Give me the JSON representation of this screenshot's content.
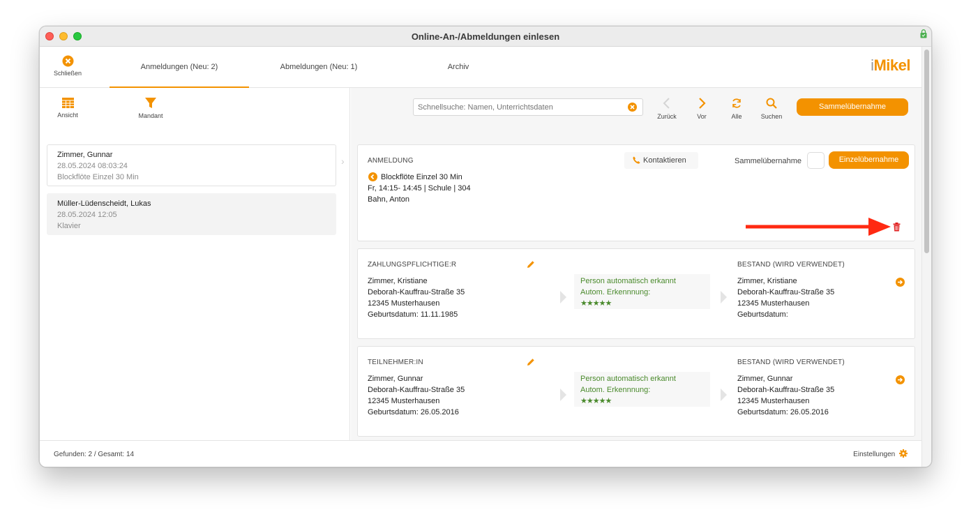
{
  "window": {
    "title": "Online-An-/Abmeldungen einlesen"
  },
  "topbar": {
    "close_label": "Schließen",
    "tabs": [
      {
        "label": "Anmeldungen (Neu: 2)",
        "active": true
      },
      {
        "label": "Abmeldungen (Neu: 1)",
        "active": false
      },
      {
        "label": "Archiv",
        "active": false
      }
    ],
    "logo": {
      "prefix": "i",
      "text": "Mikel"
    }
  },
  "left": {
    "tools": [
      {
        "label": "Ansicht",
        "icon": "grid-icon"
      },
      {
        "label": "Mandant",
        "icon": "filter-icon"
      }
    ],
    "entries": [
      {
        "name": "Zimmer, Gunnar",
        "date": "28.05.2024 08:03:24",
        "course": "Blockflöte Einzel 30 Min",
        "selected": false
      },
      {
        "name": "Müller-Lüdenscheidt, Lukas",
        "date": "28.05.2024 12:05",
        "course": "Klavier",
        "selected": true
      }
    ]
  },
  "right": {
    "search": {
      "placeholder": "Schnellsuche: Namen, Unterrichtsdaten"
    },
    "nav": {
      "back": "Zurück",
      "next": "Vor",
      "all": "Alle",
      "search": "Suchen"
    },
    "bulk_button": "Sammelübernahme",
    "anmeldung": {
      "heading": "ANMELDUNG",
      "contact": "Kontaktieren",
      "bulk_label": "Sammelübernahme",
      "single_button": "Einzelübernahme",
      "course": "Blockflöte Einzel 30 Min",
      "schedule": "Fr, 14:15- 14:45 | Schule | 304",
      "teacher": "Bahn, Anton"
    },
    "payer": {
      "heading": "ZAHLUNGSPFLICHTIGE:R",
      "lines": [
        "Zimmer, Kristiane",
        "Deborah-Kauffrau-Straße 35",
        "12345 Musterhausen",
        "Geburtsdatum: 11.11.1985"
      ],
      "match": [
        "Person automatisch erkannt",
        "Autom. Erkennnung:",
        "★★★★★"
      ],
      "existing_heading": "BESTAND (WIRD VERWENDET)",
      "existing": [
        "Zimmer, Kristiane",
        "Deborah-Kauffrau-Straße 35",
        "12345 Musterhausen",
        "Geburtsdatum:"
      ]
    },
    "participant": {
      "heading": "TEILNEHMER:IN",
      "lines": [
        "Zimmer, Gunnar",
        "Deborah-Kauffrau-Straße 35",
        "12345 Musterhausen",
        "Geburtsdatum: 26.05.2016"
      ],
      "match": [
        "Person automatisch erkannt",
        "Autom. Erkennnung:",
        "★★★★★"
      ],
      "existing_heading": "BESTAND (WIRD VERWENDET)",
      "existing": [
        "Zimmer, Gunnar",
        "Deborah-Kauffrau-Straße 35",
        "12345 Musterhausen",
        "Geburtsdatum: 26.05.2016"
      ]
    }
  },
  "footer": {
    "status": "Gefunden: 2 / Gesamt: 14",
    "settings": "Einstellungen"
  },
  "colors": {
    "accent": "#f39200",
    "annotation_arrow": "#ff2a12",
    "delete": "#e02020",
    "match_green": "#4a8a2c"
  }
}
